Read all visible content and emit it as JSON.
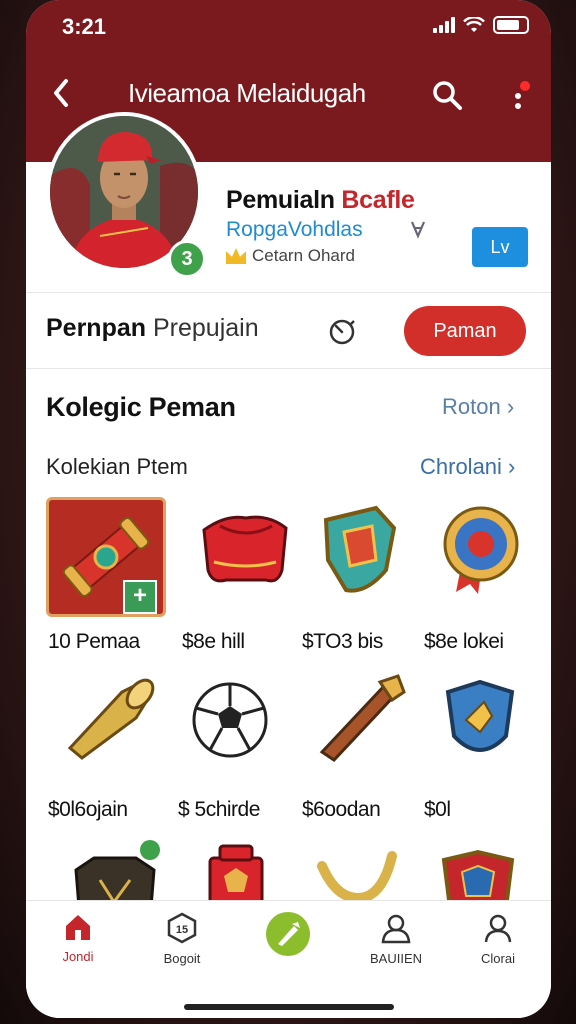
{
  "status_bar": {
    "time": "3:21"
  },
  "header": {
    "title": "Ivieamoa Melaidugah"
  },
  "profile": {
    "name_main": "Pemuialn ",
    "name_highlight": "Bcafle",
    "subtitle": "RopgaVohdlas",
    "rank_label": "Cetarn Ohard",
    "level_button": "Lv",
    "avatar_badge": "3"
  },
  "section_player": {
    "title_bold": "Pernpan",
    "title_rest": "Prepujain",
    "action_button": "Paman"
  },
  "collection": {
    "title": "Kolegic Peman",
    "link": "Roton",
    "sub_title": "Kolekian Ptem",
    "sub_link": "Chrolani",
    "items": [
      {
        "caption": "10 Pemaa",
        "icon": "scroll-icon"
      },
      {
        "caption": "$8e hill",
        "icon": "jersey-icon"
      },
      {
        "caption": "$TO3 bis",
        "icon": "crest-shield-icon"
      },
      {
        "caption": "$8e lokei",
        "icon": "medal-icon"
      },
      {
        "caption": "$0l6ojain",
        "icon": "vuvuzela-icon"
      },
      {
        "caption": "$ 5chirde",
        "icon": "soccer-ball-icon"
      },
      {
        "caption": "$6oodan",
        "icon": "horn-icon"
      },
      {
        "caption": "$0l",
        "icon": "blue-shield-icon"
      },
      {
        "caption": "",
        "icon": "black-jersey-icon"
      },
      {
        "caption": "",
        "icon": "red-trophy-icon"
      },
      {
        "caption": "",
        "icon": "slingshot-icon"
      },
      {
        "caption": "",
        "icon": "red-shield-icon"
      }
    ],
    "plus_label": "+"
  },
  "bottom_nav": {
    "items": [
      {
        "label": "Jondi",
        "icon": "home-icon"
      },
      {
        "label": "Bogoit",
        "icon": "hexagon-icon"
      },
      {
        "label": "",
        "icon": "action-icon"
      },
      {
        "label": "BAUIIEN",
        "icon": "user-icon"
      },
      {
        "label": "Clorai",
        "icon": "profile-icon"
      }
    ]
  },
  "colors": {
    "header": "#7a1a1e",
    "accent_red": "#d22f2a",
    "accent_blue": "#1e8fde",
    "accent_green": "#3fa24a"
  }
}
